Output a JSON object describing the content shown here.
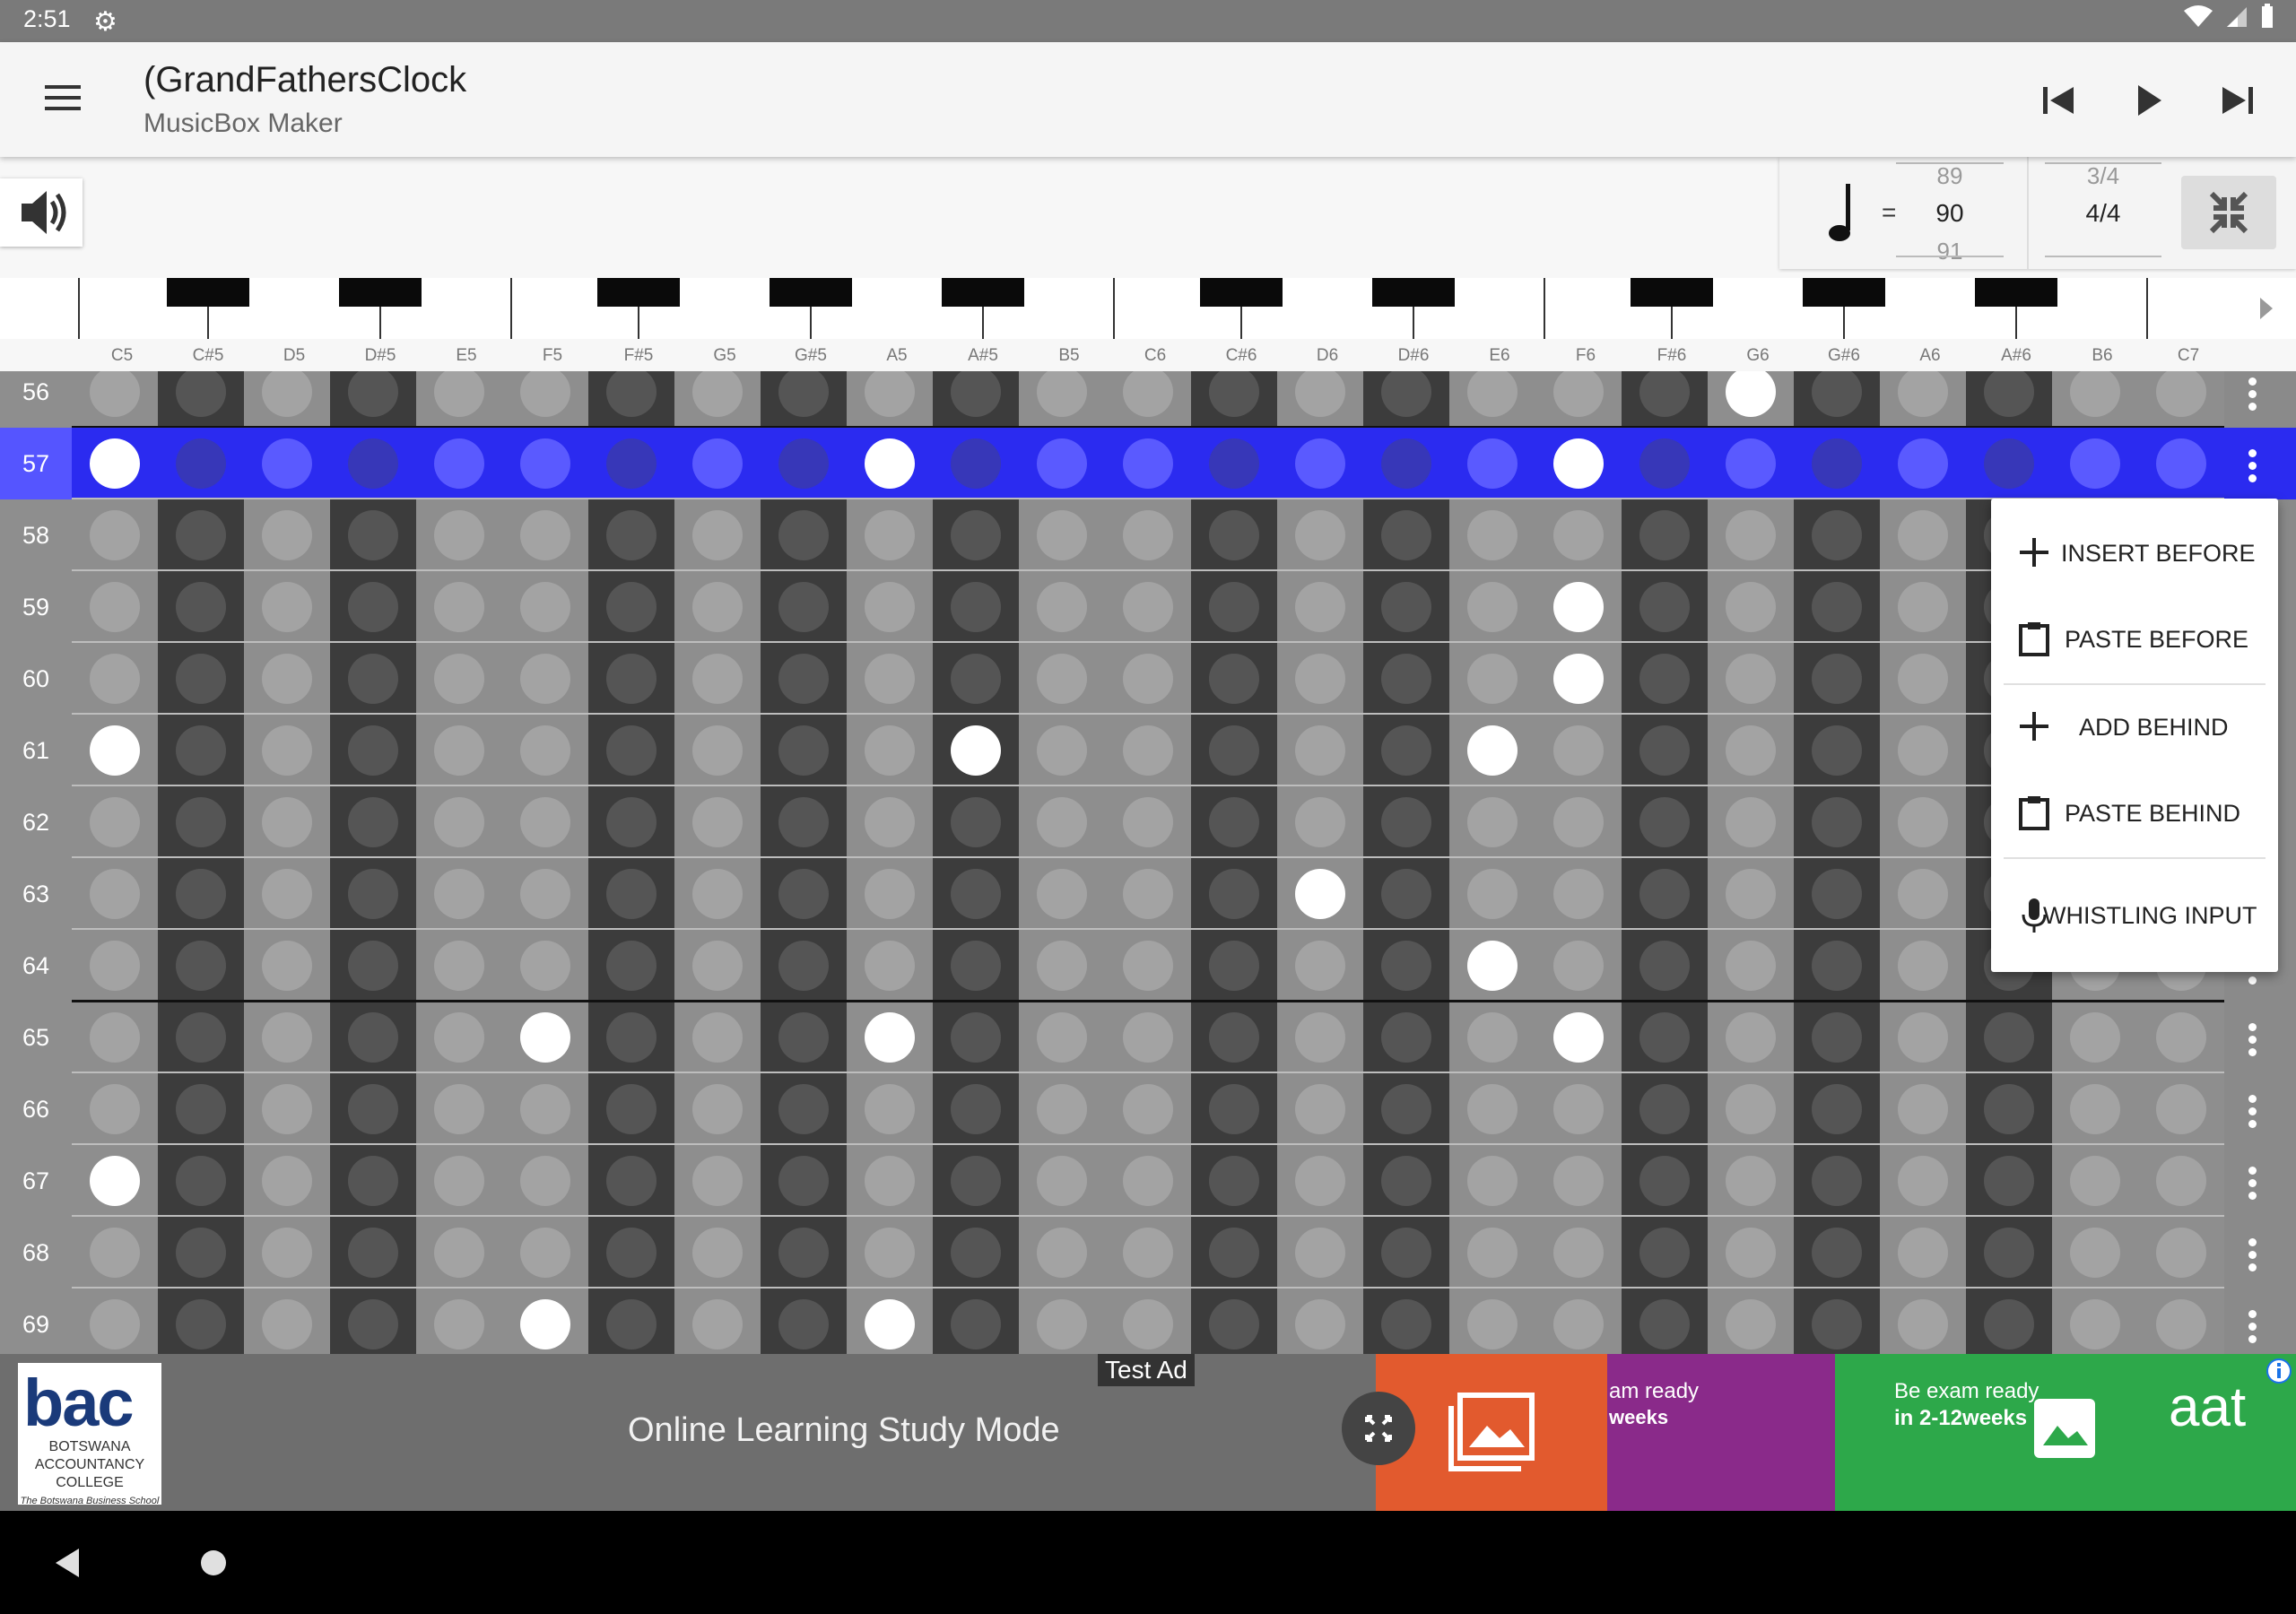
{
  "status_bar": {
    "time": "2:51",
    "settings_icon": "gear-icon",
    "wifi_icon": "wifi-icon",
    "signal_icon": "signal-icon",
    "battery_icon": "battery-icon"
  },
  "app_bar": {
    "title": "(GrandFathersClock",
    "subtitle": "MusicBox Maker",
    "menu_icon": "hamburger-menu-icon",
    "prev_icon": "skip-previous-icon",
    "play_icon": "play-icon",
    "next_icon": "skip-next-icon"
  },
  "toolbar": {
    "volume_icon": "volume-icon",
    "tempo": {
      "note_icon": "quarter-note-icon",
      "equals": "=",
      "prev": "89",
      "current": "90",
      "next": "91"
    },
    "time_signature": {
      "prev": "3/4",
      "current": "4/4"
    },
    "collapse_icon": "collapse-icon",
    "scroll_icon": "chevron-right-icon"
  },
  "notes": [
    "C5",
    "C#5",
    "D5",
    "D#5",
    "E5",
    "F5",
    "F#5",
    "G5",
    "G#5",
    "A5",
    "A#5",
    "B5",
    "C6",
    "C#6",
    "D6",
    "D#6",
    "E6",
    "F6",
    "F#6",
    "G6",
    "G#6",
    "A6",
    "A#6",
    "B6",
    "C7"
  ],
  "rows": [
    {
      "num": "56",
      "on": [
        "G6"
      ]
    },
    {
      "num": "57",
      "on": [
        "C5",
        "A5",
        "F6"
      ],
      "selected": true
    },
    {
      "num": "58",
      "on": []
    },
    {
      "num": "59",
      "on": [
        "F6"
      ]
    },
    {
      "num": "60",
      "on": [
        "F6"
      ]
    },
    {
      "num": "61",
      "on": [
        "C5",
        "A#5",
        "E6"
      ]
    },
    {
      "num": "62",
      "on": []
    },
    {
      "num": "63",
      "on": [
        "D6"
      ]
    },
    {
      "num": "64",
      "on": [
        "E6"
      ]
    },
    {
      "num": "65",
      "on": [
        "F5",
        "A5",
        "F6"
      ]
    },
    {
      "num": "66",
      "on": []
    },
    {
      "num": "67",
      "on": [
        "C5"
      ]
    },
    {
      "num": "68",
      "on": []
    },
    {
      "num": "69",
      "on": [
        "F5",
        "A5"
      ]
    }
  ],
  "context_menu": {
    "items": [
      {
        "label": "INSERT BEFORE",
        "icon": "plus-icon"
      },
      {
        "label": "PASTE BEFORE",
        "icon": "clipboard-icon"
      },
      {
        "label": "ADD BEHIND",
        "icon": "plus-icon"
      },
      {
        "label": "PASTE BEHIND",
        "icon": "clipboard-icon"
      },
      {
        "label": "WHISTLING INPUT",
        "icon": "microphone-icon"
      }
    ]
  },
  "ad": {
    "badge": "Test Ad",
    "text": "Online Learning Study Mode",
    "logo_text": "bac",
    "logo_sub": [
      "BOTSWANA",
      "ACCOUNTANCY",
      "COLLEGE",
      "The Botswana Business School"
    ],
    "banner_text_1": "am ready",
    "banner_text_2": "weeks",
    "banner_text_3": "Be exam ready",
    "banner_text_4": "in 2-12weeks",
    "banner_text_5": "aat",
    "info_icon": "info-icon",
    "expand_icon": "expand-icon",
    "image_icon": "image-icon"
  },
  "nav_bar": {
    "back_icon": "back-triangle-icon",
    "home_icon": "home-circle-icon"
  },
  "colors": {
    "selected_row": "#2b2bf0",
    "light_col": "#8e8e8e",
    "dark_col": "#3c3c3c",
    "on_dot": "#ffffff"
  }
}
